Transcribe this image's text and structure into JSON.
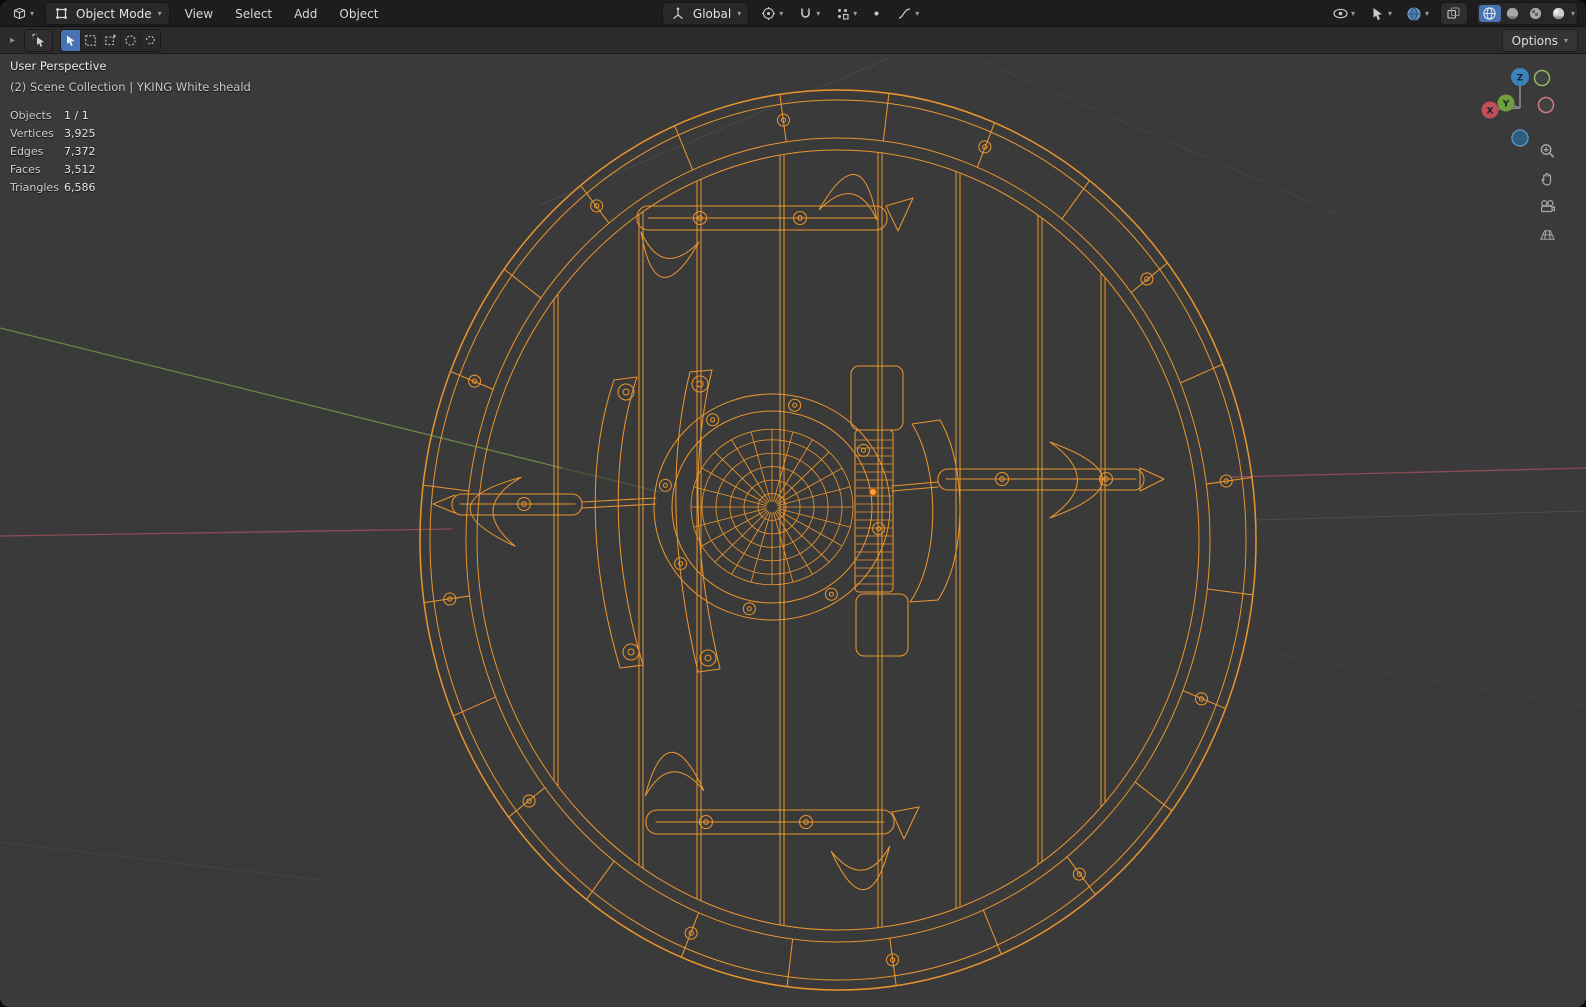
{
  "header": {
    "mode": "Object Mode",
    "menus": [
      "View",
      "Select",
      "Add",
      "Object"
    ],
    "orientation": "Global",
    "options": "Options"
  },
  "viewport": {
    "perspective": "User Perspective",
    "collection": "(2) Scene Collection | YKING White sheald",
    "stats": [
      {
        "label": "Objects",
        "value": "1 / 1"
      },
      {
        "label": "Vertices",
        "value": "3,925"
      },
      {
        "label": "Edges",
        "value": "7,372"
      },
      {
        "label": "Faces",
        "value": "3,512"
      },
      {
        "label": "Triangles",
        "value": "6,586"
      }
    ]
  },
  "gizmo": {
    "x": "X",
    "y": "Y",
    "z": "Z"
  },
  "icons": {
    "chevron": "▾",
    "expander": "▸"
  },
  "colors": {
    "wire": "#e8952f",
    "origin": "#ff9d2e",
    "axis_x": "#c24e5c",
    "axis_y": "#6f9e3c",
    "axis_z": "#3b83bd",
    "accent": "#4772b3",
    "overlay_globe": "#4e7fae"
  }
}
